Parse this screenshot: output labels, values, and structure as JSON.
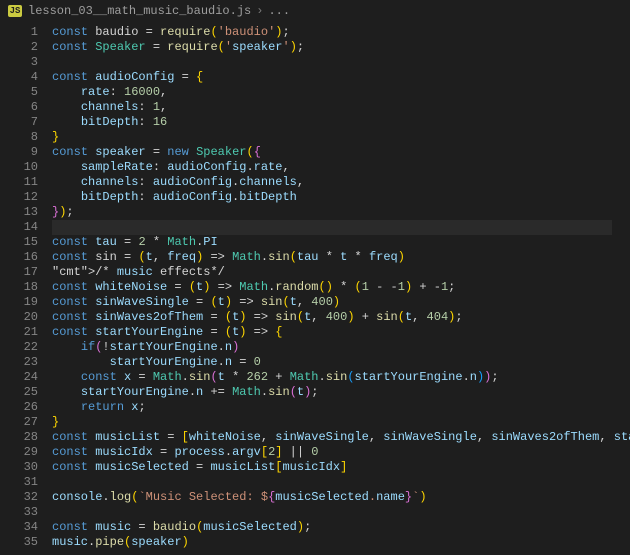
{
  "tab": {
    "icon_label": "JS",
    "filename": "lesson_03__math_music_baudio.js",
    "breadcrumb_tail": "..."
  },
  "first_line": 1,
  "last_line": 35,
  "highlighted_line": 14,
  "code_lines": {
    "1": "const baudio = require('baudio');",
    "2": "const Speaker = require('speaker');",
    "3": "",
    "4": "const audioConfig = {",
    "5": "    rate: 16000,",
    "6": "    channels: 1,",
    "7": "    bitDepth: 16",
    "8": "}",
    "9": "const speaker = new Speaker({",
    "10": "    sampleRate: audioConfig.rate,",
    "11": "    channels: audioConfig.channels,",
    "12": "    bitDepth: audioConfig.bitDepth",
    "13": "});",
    "14": "",
    "15": "const tau = 2 * Math.PI",
    "16": "const sin = (t, freq) => Math.sin(tau * t * freq)",
    "17": "/* music effects*/",
    "18": "const whiteNoise = (t) => Math.random() * (1 - -1) + -1;",
    "19": "const sinWaveSingle = (t) => sin(t, 400)",
    "20": "const sinWaves2ofThem = (t) => sin(t, 400) + sin(t, 404);",
    "21": "const startYourEngine = (t) => {",
    "22": "    if(!startYourEngine.n)",
    "23": "        startYourEngine.n = 0",
    "24": "    const x = Math.sin(t * 262 + Math.sin(startYourEngine.n));",
    "25": "    startYourEngine.n += Math.sin(t);",
    "26": "    return x;",
    "27": "}",
    "28": "const musicList = [whiteNoise, sinWaveSingle, sinWaveSingle, sinWaves2ofThem, startYourEngine]",
    "29": "const musicIdx = process.argv[2] || 0",
    "30": "const musicSelected = musicList[musicIdx]",
    "31": "",
    "32": "console.log(`Music Selected: ${musicSelected.name}`)",
    "33": "",
    "34": "const music = baudio(musicSelected);",
    "35": "music.pipe(speaker)"
  }
}
